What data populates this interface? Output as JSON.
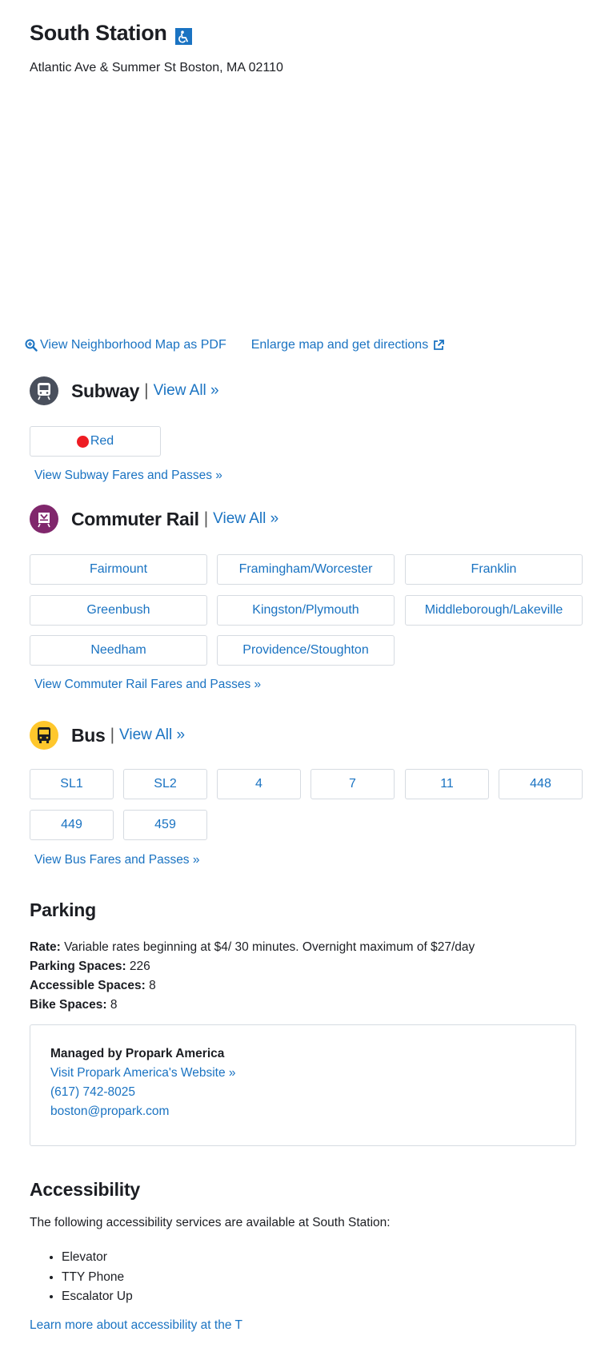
{
  "station": {
    "name": "South Station",
    "address": "Atlantic Ave & Summer St Boston, MA 02110"
  },
  "map_links": {
    "pdf": "View Neighborhood Map as PDF",
    "enlarge": "Enlarge map and get directions"
  },
  "subway": {
    "title": "Subway",
    "view_all": "View All »",
    "routes": [
      "Red"
    ],
    "fares_link": "View Subway Fares and Passes »",
    "icon_color": "#494f5c"
  },
  "commuter_rail": {
    "title": "Commuter Rail",
    "view_all": "View All »",
    "routes": [
      "Fairmount",
      "Framingham/Worcester",
      "Franklin",
      "Greenbush",
      "Kingston/Plymouth",
      "Middleborough/Lakeville",
      "Needham",
      "Providence/Stoughton"
    ],
    "fares_link": "View Commuter Rail Fares and Passes »",
    "icon_color": "#80276c"
  },
  "bus": {
    "title": "Bus",
    "view_all": "View All »",
    "routes": [
      "SL1",
      "SL2",
      "4",
      "7",
      "11",
      "448",
      "449",
      "459"
    ],
    "fares_link": "View Bus Fares and Passes »",
    "icon_color": "#ffc72c"
  },
  "parking": {
    "heading": "Parking",
    "rate_label": "Rate:",
    "rate_value": "Variable rates beginning at $4/ 30 minutes. Overnight maximum of $27/day",
    "spaces_label": "Parking Spaces:",
    "spaces_value": "226",
    "accessible_label": "Accessible Spaces:",
    "accessible_value": "8",
    "bike_label": "Bike Spaces:",
    "bike_value": "8",
    "manager": {
      "name": "Managed by Propark America",
      "website": "Visit Propark America's Website »",
      "phone": "(617) 742-8025",
      "email": "boston@propark.com"
    }
  },
  "accessibility": {
    "heading": "Accessibility",
    "intro": "The following accessibility services are available at South Station:",
    "services": [
      "Elevator",
      "TTY Phone",
      "Escalator Up"
    ],
    "learn_more": "Learn more about accessibility at the T"
  },
  "colors": {
    "link": "#1a73c2",
    "red_line": "#ee1c23",
    "border": "#d6dbe1"
  }
}
